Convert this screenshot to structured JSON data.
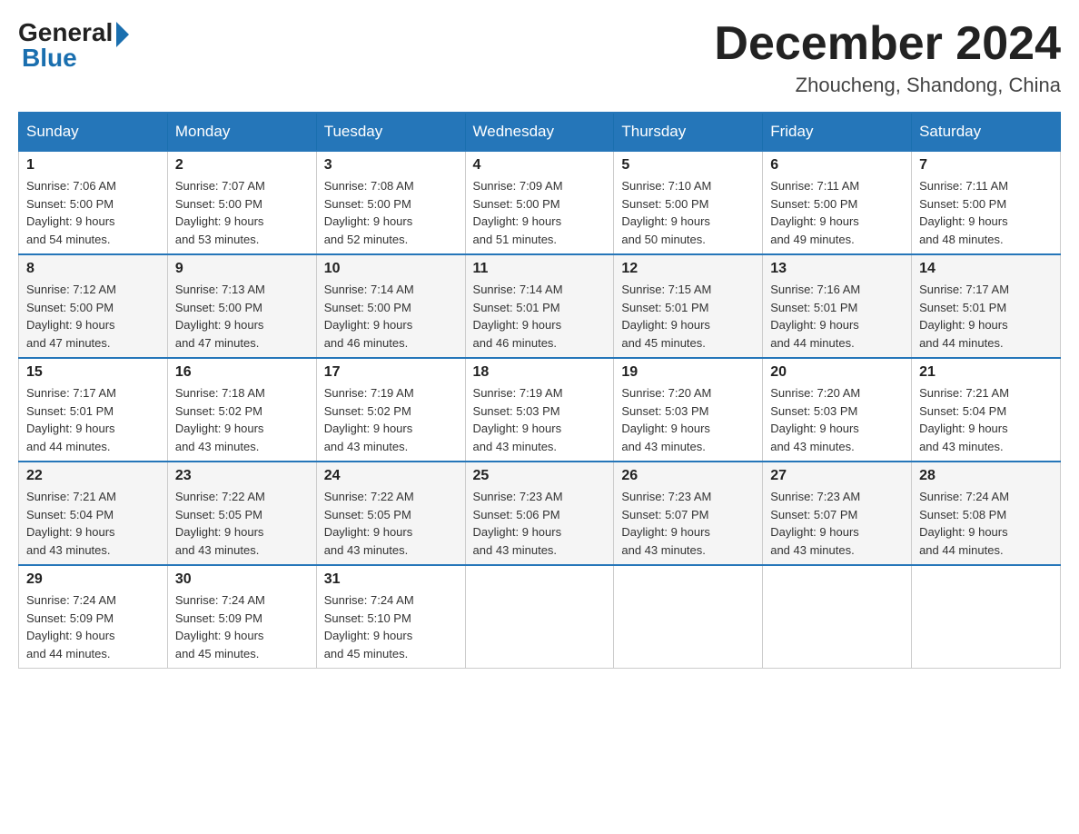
{
  "logo": {
    "general": "General",
    "blue": "Blue"
  },
  "header": {
    "month": "December 2024",
    "location": "Zhoucheng, Shandong, China"
  },
  "columns": [
    "Sunday",
    "Monday",
    "Tuesday",
    "Wednesday",
    "Thursday",
    "Friday",
    "Saturday"
  ],
  "weeks": [
    [
      {
        "day": "1",
        "sunrise": "Sunrise: 7:06 AM",
        "sunset": "Sunset: 5:00 PM",
        "daylight": "Daylight: 9 hours",
        "daylight2": "and 54 minutes."
      },
      {
        "day": "2",
        "sunrise": "Sunrise: 7:07 AM",
        "sunset": "Sunset: 5:00 PM",
        "daylight": "Daylight: 9 hours",
        "daylight2": "and 53 minutes."
      },
      {
        "day": "3",
        "sunrise": "Sunrise: 7:08 AM",
        "sunset": "Sunset: 5:00 PM",
        "daylight": "Daylight: 9 hours",
        "daylight2": "and 52 minutes."
      },
      {
        "day": "4",
        "sunrise": "Sunrise: 7:09 AM",
        "sunset": "Sunset: 5:00 PM",
        "daylight": "Daylight: 9 hours",
        "daylight2": "and 51 minutes."
      },
      {
        "day": "5",
        "sunrise": "Sunrise: 7:10 AM",
        "sunset": "Sunset: 5:00 PM",
        "daylight": "Daylight: 9 hours",
        "daylight2": "and 50 minutes."
      },
      {
        "day": "6",
        "sunrise": "Sunrise: 7:11 AM",
        "sunset": "Sunset: 5:00 PM",
        "daylight": "Daylight: 9 hours",
        "daylight2": "and 49 minutes."
      },
      {
        "day": "7",
        "sunrise": "Sunrise: 7:11 AM",
        "sunset": "Sunset: 5:00 PM",
        "daylight": "Daylight: 9 hours",
        "daylight2": "and 48 minutes."
      }
    ],
    [
      {
        "day": "8",
        "sunrise": "Sunrise: 7:12 AM",
        "sunset": "Sunset: 5:00 PM",
        "daylight": "Daylight: 9 hours",
        "daylight2": "and 47 minutes."
      },
      {
        "day": "9",
        "sunrise": "Sunrise: 7:13 AM",
        "sunset": "Sunset: 5:00 PM",
        "daylight": "Daylight: 9 hours",
        "daylight2": "and 47 minutes."
      },
      {
        "day": "10",
        "sunrise": "Sunrise: 7:14 AM",
        "sunset": "Sunset: 5:00 PM",
        "daylight": "Daylight: 9 hours",
        "daylight2": "and 46 minutes."
      },
      {
        "day": "11",
        "sunrise": "Sunrise: 7:14 AM",
        "sunset": "Sunset: 5:01 PM",
        "daylight": "Daylight: 9 hours",
        "daylight2": "and 46 minutes."
      },
      {
        "day": "12",
        "sunrise": "Sunrise: 7:15 AM",
        "sunset": "Sunset: 5:01 PM",
        "daylight": "Daylight: 9 hours",
        "daylight2": "and 45 minutes."
      },
      {
        "day": "13",
        "sunrise": "Sunrise: 7:16 AM",
        "sunset": "Sunset: 5:01 PM",
        "daylight": "Daylight: 9 hours",
        "daylight2": "and 44 minutes."
      },
      {
        "day": "14",
        "sunrise": "Sunrise: 7:17 AM",
        "sunset": "Sunset: 5:01 PM",
        "daylight": "Daylight: 9 hours",
        "daylight2": "and 44 minutes."
      }
    ],
    [
      {
        "day": "15",
        "sunrise": "Sunrise: 7:17 AM",
        "sunset": "Sunset: 5:01 PM",
        "daylight": "Daylight: 9 hours",
        "daylight2": "and 44 minutes."
      },
      {
        "day": "16",
        "sunrise": "Sunrise: 7:18 AM",
        "sunset": "Sunset: 5:02 PM",
        "daylight": "Daylight: 9 hours",
        "daylight2": "and 43 minutes."
      },
      {
        "day": "17",
        "sunrise": "Sunrise: 7:19 AM",
        "sunset": "Sunset: 5:02 PM",
        "daylight": "Daylight: 9 hours",
        "daylight2": "and 43 minutes."
      },
      {
        "day": "18",
        "sunrise": "Sunrise: 7:19 AM",
        "sunset": "Sunset: 5:03 PM",
        "daylight": "Daylight: 9 hours",
        "daylight2": "and 43 minutes."
      },
      {
        "day": "19",
        "sunrise": "Sunrise: 7:20 AM",
        "sunset": "Sunset: 5:03 PM",
        "daylight": "Daylight: 9 hours",
        "daylight2": "and 43 minutes."
      },
      {
        "day": "20",
        "sunrise": "Sunrise: 7:20 AM",
        "sunset": "Sunset: 5:03 PM",
        "daylight": "Daylight: 9 hours",
        "daylight2": "and 43 minutes."
      },
      {
        "day": "21",
        "sunrise": "Sunrise: 7:21 AM",
        "sunset": "Sunset: 5:04 PM",
        "daylight": "Daylight: 9 hours",
        "daylight2": "and 43 minutes."
      }
    ],
    [
      {
        "day": "22",
        "sunrise": "Sunrise: 7:21 AM",
        "sunset": "Sunset: 5:04 PM",
        "daylight": "Daylight: 9 hours",
        "daylight2": "and 43 minutes."
      },
      {
        "day": "23",
        "sunrise": "Sunrise: 7:22 AM",
        "sunset": "Sunset: 5:05 PM",
        "daylight": "Daylight: 9 hours",
        "daylight2": "and 43 minutes."
      },
      {
        "day": "24",
        "sunrise": "Sunrise: 7:22 AM",
        "sunset": "Sunset: 5:05 PM",
        "daylight": "Daylight: 9 hours",
        "daylight2": "and 43 minutes."
      },
      {
        "day": "25",
        "sunrise": "Sunrise: 7:23 AM",
        "sunset": "Sunset: 5:06 PM",
        "daylight": "Daylight: 9 hours",
        "daylight2": "and 43 minutes."
      },
      {
        "day": "26",
        "sunrise": "Sunrise: 7:23 AM",
        "sunset": "Sunset: 5:07 PM",
        "daylight": "Daylight: 9 hours",
        "daylight2": "and 43 minutes."
      },
      {
        "day": "27",
        "sunrise": "Sunrise: 7:23 AM",
        "sunset": "Sunset: 5:07 PM",
        "daylight": "Daylight: 9 hours",
        "daylight2": "and 43 minutes."
      },
      {
        "day": "28",
        "sunrise": "Sunrise: 7:24 AM",
        "sunset": "Sunset: 5:08 PM",
        "daylight": "Daylight: 9 hours",
        "daylight2": "and 44 minutes."
      }
    ],
    [
      {
        "day": "29",
        "sunrise": "Sunrise: 7:24 AM",
        "sunset": "Sunset: 5:09 PM",
        "daylight": "Daylight: 9 hours",
        "daylight2": "and 44 minutes."
      },
      {
        "day": "30",
        "sunrise": "Sunrise: 7:24 AM",
        "sunset": "Sunset: 5:09 PM",
        "daylight": "Daylight: 9 hours",
        "daylight2": "and 45 minutes."
      },
      {
        "day": "31",
        "sunrise": "Sunrise: 7:24 AM",
        "sunset": "Sunset: 5:10 PM",
        "daylight": "Daylight: 9 hours",
        "daylight2": "and 45 minutes."
      },
      null,
      null,
      null,
      null
    ]
  ]
}
